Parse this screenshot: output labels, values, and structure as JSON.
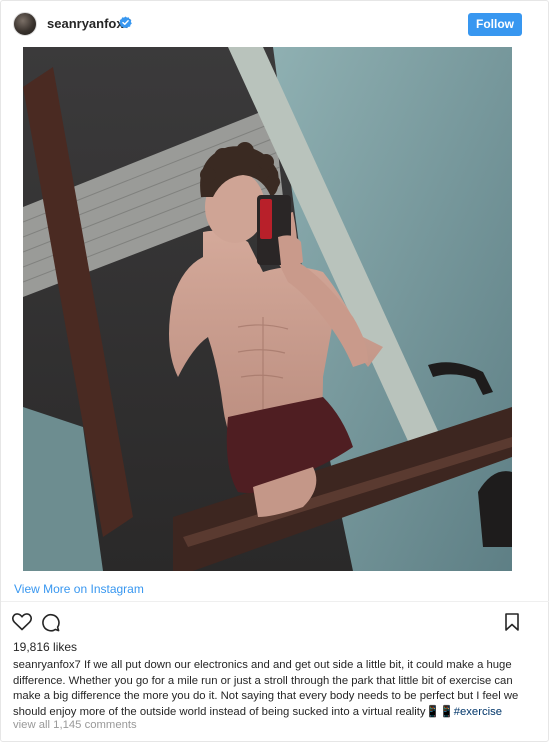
{
  "post": {
    "username": "seanryanfox7",
    "follow_label": "Follow",
    "view_more_label": "View More on Instagram",
    "likes_text": "19,816 likes",
    "caption_username": "seanryanfox7",
    "caption_text": " If we all put down our electronics and and get out side a little bit, it could make a huge difference. Whether you go for a mile run or just a stroll through the park that little bit of exercise can make a big difference the more you do it. Not saying that every body needs to be perfect but I feel we should enjoy more of the outside world instead of being sucked into a virtual reality📱📱",
    "hashtag": "#exercise",
    "view_comments_label": "view all 1,145 comments"
  },
  "icons": {
    "verified": "verified-badge-icon",
    "like": "heart-icon",
    "comment": "comment-icon",
    "save": "bookmark-icon"
  },
  "colors": {
    "accent": "#3897f0",
    "hashtag": "#003569",
    "muted": "#999999",
    "text": "#262626"
  }
}
